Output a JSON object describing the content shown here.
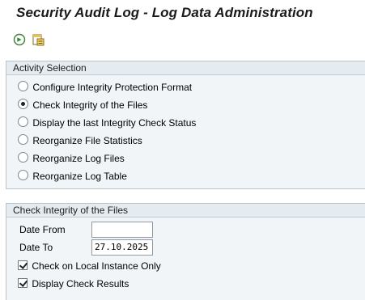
{
  "window": {
    "title": "Security Audit Log - Log Data Administration"
  },
  "toolbar": {
    "items": [
      {
        "icon": "execute-icon",
        "tooltip": ""
      },
      {
        "icon": "variant-icon",
        "tooltip": ""
      }
    ]
  },
  "activity": {
    "header": "Activity Selection",
    "options": [
      {
        "label": "Configure Integrity Protection Format",
        "selected": false
      },
      {
        "label": "Check Integrity of the Files",
        "selected": true
      },
      {
        "label": "Display the last Integrity Check Status",
        "selected": false
      },
      {
        "label": "Reorganize File Statistics",
        "selected": false
      },
      {
        "label": "Reorganize Log Files",
        "selected": false
      },
      {
        "label": "Reorganize Log Table",
        "selected": false
      }
    ]
  },
  "check": {
    "header": "Check Integrity of the Files",
    "date_from_label": "Date From",
    "date_from_value": "",
    "date_to_label": "Date To",
    "date_to_value": "27.10.2025",
    "local_only_label": "Check on Local Instance Only",
    "local_only_checked": true,
    "display_results_label": "Display Check Results",
    "display_results_checked": true
  },
  "colors": {
    "panel_bg": "#f2f5f8",
    "panel_header_bg": "#e4ecf2",
    "execute_icon": "#2f8a2f"
  }
}
